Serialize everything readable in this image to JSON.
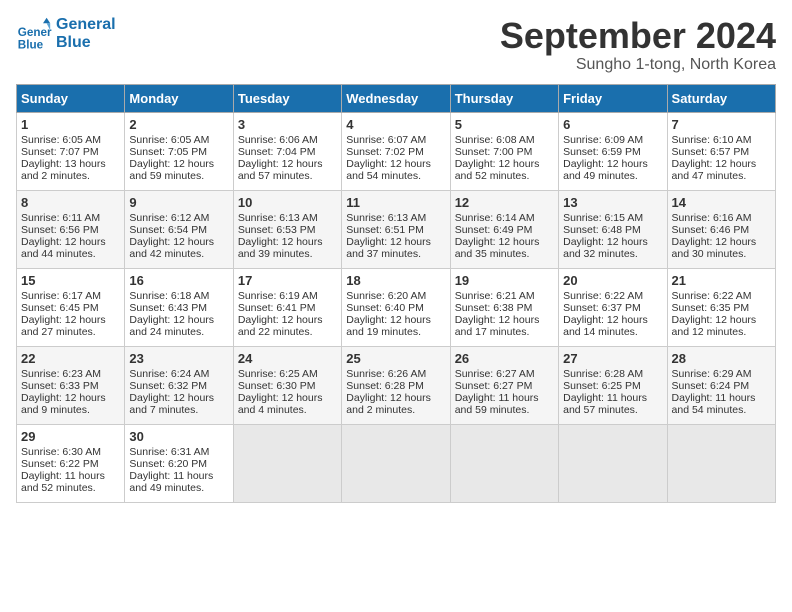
{
  "logo": {
    "line1": "General",
    "line2": "Blue"
  },
  "title": "September 2024",
  "location": "Sungho 1-tong, North Korea",
  "days_of_week": [
    "Sunday",
    "Monday",
    "Tuesday",
    "Wednesday",
    "Thursday",
    "Friday",
    "Saturday"
  ],
  "weeks": [
    [
      {
        "day": 1,
        "content": "Sunrise: 6:05 AM\nSunset: 7:07 PM\nDaylight: 13 hours\nand 2 minutes."
      },
      {
        "day": 2,
        "content": "Sunrise: 6:05 AM\nSunset: 7:05 PM\nDaylight: 12 hours\nand 59 minutes."
      },
      {
        "day": 3,
        "content": "Sunrise: 6:06 AM\nSunset: 7:04 PM\nDaylight: 12 hours\nand 57 minutes."
      },
      {
        "day": 4,
        "content": "Sunrise: 6:07 AM\nSunset: 7:02 PM\nDaylight: 12 hours\nand 54 minutes."
      },
      {
        "day": 5,
        "content": "Sunrise: 6:08 AM\nSunset: 7:00 PM\nDaylight: 12 hours\nand 52 minutes."
      },
      {
        "day": 6,
        "content": "Sunrise: 6:09 AM\nSunset: 6:59 PM\nDaylight: 12 hours\nand 49 minutes."
      },
      {
        "day": 7,
        "content": "Sunrise: 6:10 AM\nSunset: 6:57 PM\nDaylight: 12 hours\nand 47 minutes."
      }
    ],
    [
      {
        "day": 8,
        "content": "Sunrise: 6:11 AM\nSunset: 6:56 PM\nDaylight: 12 hours\nand 44 minutes."
      },
      {
        "day": 9,
        "content": "Sunrise: 6:12 AM\nSunset: 6:54 PM\nDaylight: 12 hours\nand 42 minutes."
      },
      {
        "day": 10,
        "content": "Sunrise: 6:13 AM\nSunset: 6:53 PM\nDaylight: 12 hours\nand 39 minutes."
      },
      {
        "day": 11,
        "content": "Sunrise: 6:13 AM\nSunset: 6:51 PM\nDaylight: 12 hours\nand 37 minutes."
      },
      {
        "day": 12,
        "content": "Sunrise: 6:14 AM\nSunset: 6:49 PM\nDaylight: 12 hours\nand 35 minutes."
      },
      {
        "day": 13,
        "content": "Sunrise: 6:15 AM\nSunset: 6:48 PM\nDaylight: 12 hours\nand 32 minutes."
      },
      {
        "day": 14,
        "content": "Sunrise: 6:16 AM\nSunset: 6:46 PM\nDaylight: 12 hours\nand 30 minutes."
      }
    ],
    [
      {
        "day": 15,
        "content": "Sunrise: 6:17 AM\nSunset: 6:45 PM\nDaylight: 12 hours\nand 27 minutes."
      },
      {
        "day": 16,
        "content": "Sunrise: 6:18 AM\nSunset: 6:43 PM\nDaylight: 12 hours\nand 24 minutes."
      },
      {
        "day": 17,
        "content": "Sunrise: 6:19 AM\nSunset: 6:41 PM\nDaylight: 12 hours\nand 22 minutes."
      },
      {
        "day": 18,
        "content": "Sunrise: 6:20 AM\nSunset: 6:40 PM\nDaylight: 12 hours\nand 19 minutes."
      },
      {
        "day": 19,
        "content": "Sunrise: 6:21 AM\nSunset: 6:38 PM\nDaylight: 12 hours\nand 17 minutes."
      },
      {
        "day": 20,
        "content": "Sunrise: 6:22 AM\nSunset: 6:37 PM\nDaylight: 12 hours\nand 14 minutes."
      },
      {
        "day": 21,
        "content": "Sunrise: 6:22 AM\nSunset: 6:35 PM\nDaylight: 12 hours\nand 12 minutes."
      }
    ],
    [
      {
        "day": 22,
        "content": "Sunrise: 6:23 AM\nSunset: 6:33 PM\nDaylight: 12 hours\nand 9 minutes."
      },
      {
        "day": 23,
        "content": "Sunrise: 6:24 AM\nSunset: 6:32 PM\nDaylight: 12 hours\nand 7 minutes."
      },
      {
        "day": 24,
        "content": "Sunrise: 6:25 AM\nSunset: 6:30 PM\nDaylight: 12 hours\nand 4 minutes."
      },
      {
        "day": 25,
        "content": "Sunrise: 6:26 AM\nSunset: 6:28 PM\nDaylight: 12 hours\nand 2 minutes."
      },
      {
        "day": 26,
        "content": "Sunrise: 6:27 AM\nSunset: 6:27 PM\nDaylight: 11 hours\nand 59 minutes."
      },
      {
        "day": 27,
        "content": "Sunrise: 6:28 AM\nSunset: 6:25 PM\nDaylight: 11 hours\nand 57 minutes."
      },
      {
        "day": 28,
        "content": "Sunrise: 6:29 AM\nSunset: 6:24 PM\nDaylight: 11 hours\nand 54 minutes."
      }
    ],
    [
      {
        "day": 29,
        "content": "Sunrise: 6:30 AM\nSunset: 6:22 PM\nDaylight: 11 hours\nand 52 minutes."
      },
      {
        "day": 30,
        "content": "Sunrise: 6:31 AM\nSunset: 6:20 PM\nDaylight: 11 hours\nand 49 minutes."
      },
      {
        "day": null,
        "content": ""
      },
      {
        "day": null,
        "content": ""
      },
      {
        "day": null,
        "content": ""
      },
      {
        "day": null,
        "content": ""
      },
      {
        "day": null,
        "content": ""
      }
    ]
  ]
}
